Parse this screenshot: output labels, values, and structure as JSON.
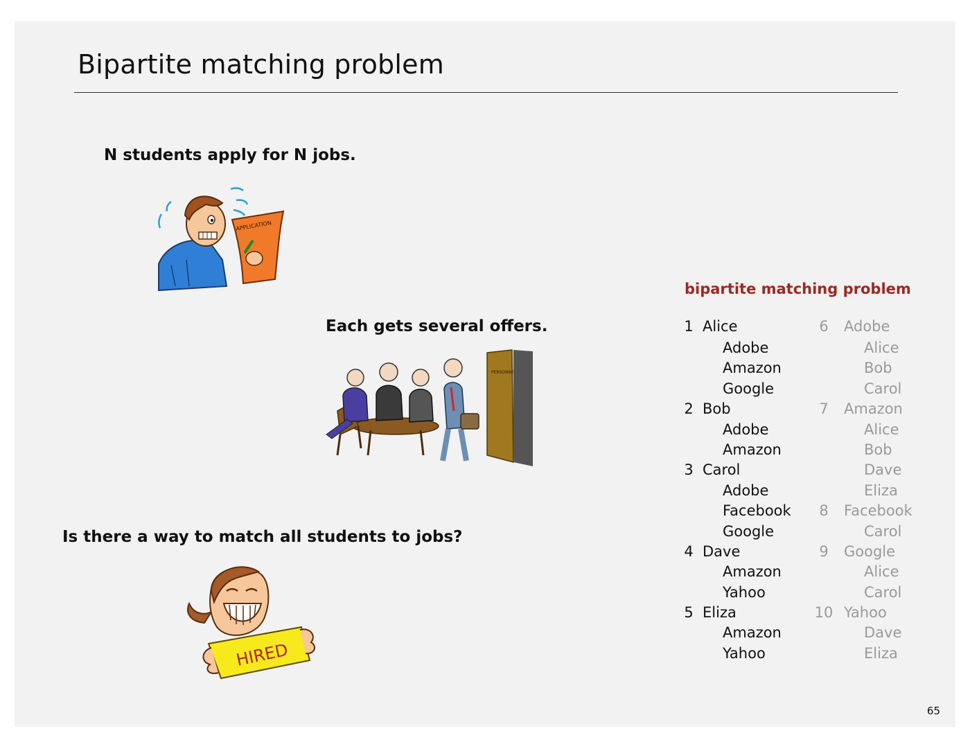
{
  "slide": {
    "title": "Bipartite matching problem",
    "page_number": "65"
  },
  "bullets": {
    "b1": "N students apply for N jobs.",
    "b2": "Each gets several offers.",
    "b3": "Is there a way to match all students to jobs?"
  },
  "illustrations": {
    "student_art_text": "APPLICATION",
    "interview_door_text": "PERSONNEL",
    "hired_art_text": "HIRED"
  },
  "panel": {
    "title": "bipartite matching problem",
    "students": [
      {
        "num": "1",
        "name": "Alice",
        "jobs": [
          "Adobe",
          "Amazon",
          "Google"
        ]
      },
      {
        "num": "2",
        "name": "Bob",
        "jobs": [
          "Adobe",
          "Amazon"
        ]
      },
      {
        "num": "3",
        "name": "Carol",
        "jobs": [
          "Adobe",
          "Facebook",
          "Google"
        ]
      },
      {
        "num": "4",
        "name": "Dave",
        "jobs": [
          "Amazon",
          "Yahoo"
        ]
      },
      {
        "num": "5",
        "name": "Eliza",
        "jobs": [
          "Amazon",
          "Yahoo"
        ]
      }
    ],
    "jobs": [
      {
        "num": "6",
        "name": "Adobe",
        "students": [
          "Alice",
          "Bob",
          "Carol"
        ]
      },
      {
        "num": "7",
        "name": "Amazon",
        "students": [
          "Alice",
          "Bob",
          "Dave",
          "Eliza"
        ]
      },
      {
        "num": "8",
        "name": "Facebook",
        "students": [
          "Carol"
        ]
      },
      {
        "num": "9",
        "name": "Google",
        "students": [
          "Alice",
          "Carol"
        ]
      },
      {
        "num": "10",
        "name": "Yahoo",
        "students": [
          "Dave",
          "Eliza"
        ]
      }
    ]
  },
  "colors": {
    "panel_title": "#9b2a22",
    "job_list_text": "#9a9a9a",
    "slide_background": "#f2f2f2"
  }
}
